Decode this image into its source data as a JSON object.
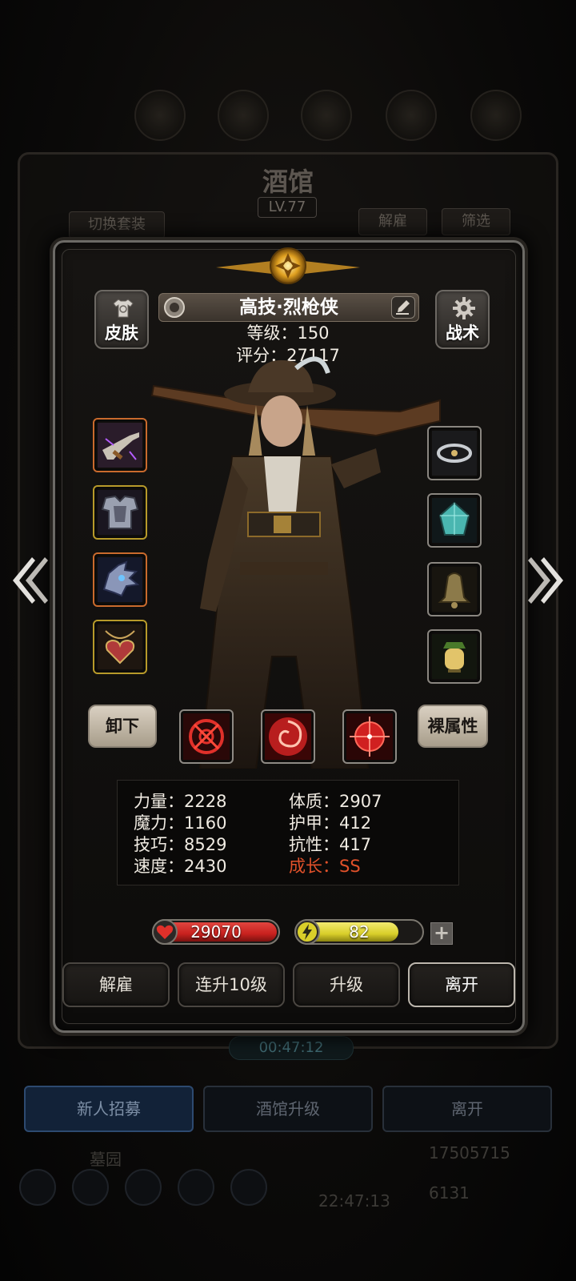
{
  "background": {
    "tavern_title": "酒馆",
    "tavern_level": "LV.77",
    "switch_outfit_label": "切换套装",
    "dismiss_label": "解雇",
    "filter_label": "筛选",
    "timer": "00:47:12",
    "tabs": [
      {
        "label": "新人招募",
        "active": true
      },
      {
        "label": "酒馆升级",
        "active": false
      },
      {
        "label": "离开",
        "active": false
      }
    ],
    "graveyard_label": "墓园",
    "gold": "17505715",
    "gems": "6131",
    "clock": "22:47:13"
  },
  "hero": {
    "name": "高技·烈枪侠",
    "level_line": "等级：150",
    "score_line": "评分：27117",
    "skin_label": "皮肤",
    "tactics_label": "战术"
  },
  "equipment": {
    "left": [
      "flintlock-pistol-icon",
      "chest-armor-icon",
      "dragon-helm-icon",
      "heart-amulet-icon"
    ],
    "right": [
      "cloud-ring-icon",
      "crystal-gem-icon",
      "bronze-bell-icon",
      "lantern-icon"
    ]
  },
  "buttons": {
    "unequip_label": "卸下",
    "bare_stats_label": "裸属性"
  },
  "skills": [
    "crosshair-skill-icon",
    "vortex-skill-icon",
    "target-skill-icon"
  ],
  "stats": {
    "strength": "力量：2228",
    "magic": "魔力：1160",
    "skill": "技巧：8529",
    "speed": "速度：2430",
    "constitution": "体质：2907",
    "armor": "护甲：412",
    "resistance": "抗性：417",
    "growth": "成长：SS"
  },
  "vitals": {
    "hp": "29070",
    "hp_fill": 1.0,
    "energy": "82",
    "energy_fill": 0.82
  },
  "actions": {
    "dismiss": "解雇",
    "level_up_10": "连升10级",
    "level_up": "升级",
    "leave": "离开"
  },
  "colors": {
    "hp": "#c8211e",
    "energy": "#d9cf2a",
    "growth": "#e0512a"
  }
}
